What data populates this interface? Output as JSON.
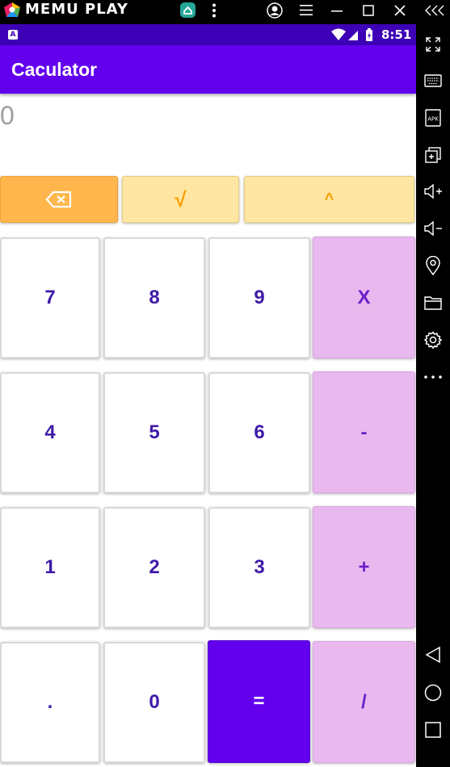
{
  "emulator": {
    "title": "MEMU PLAY",
    "colors": {
      "logo_pink": "#e91e63",
      "logo_green": "#4caf50",
      "logo_blue": "#2196f3",
      "logo_yellow": "#ffc107",
      "app_icon": "#26a69a"
    }
  },
  "statusbar": {
    "notification_icon": "A",
    "time": "8:51",
    "icons": [
      "wifi-icon",
      "signal-icon",
      "battery-icon"
    ]
  },
  "appbar": {
    "title": "Caculator"
  },
  "display": {
    "value": "0"
  },
  "keypad": {
    "top_row": {
      "backspace_icon": "backspace-icon",
      "sqrt": "√",
      "power": "^"
    },
    "rows": [
      [
        "7",
        "8",
        "9",
        "X"
      ],
      [
        "4",
        "5",
        "6",
        "-"
      ],
      [
        "1",
        "2",
        "3",
        "+"
      ],
      [
        ".",
        "0",
        "=",
        "/"
      ]
    ]
  },
  "colors": {
    "primary": "#6200ee",
    "status_bar": "#3d00b6",
    "backspace_bg": "#ffb74d",
    "function_bg": "#ffe6a3",
    "function_text": "#f5a000",
    "operator_bg": "#e8b8ef",
    "number_text": "#3f1aa8"
  },
  "sidebar": {
    "icons": [
      "chevrons-left-icon",
      "fullscreen-icon",
      "keyboard-icon",
      "apk-icon",
      "add-window-icon",
      "volume-up-icon",
      "volume-down-icon",
      "location-icon",
      "folder-icon",
      "settings-icon",
      "more-icon",
      "back-icon",
      "home-icon",
      "recents-icon"
    ],
    "apk_label": "APK"
  }
}
